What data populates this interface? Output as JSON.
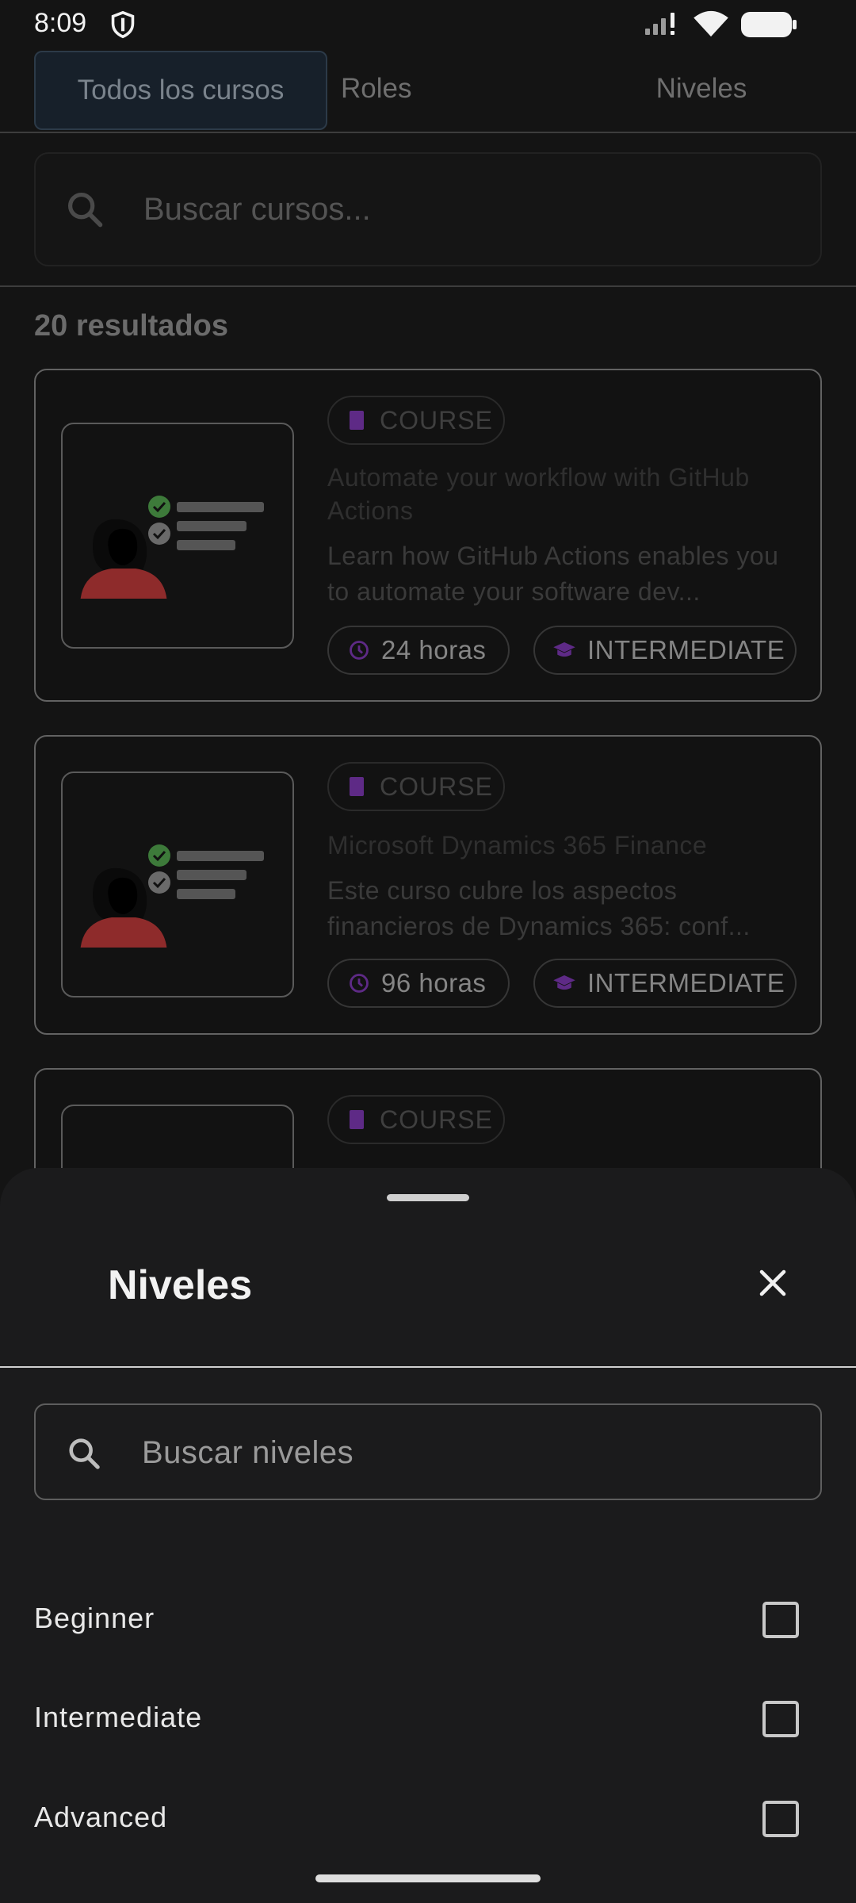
{
  "status_bar": {
    "time": "8:09"
  },
  "tabs": [
    {
      "label": "Todos los cursos"
    },
    {
      "label": "Roles"
    },
    {
      "label": "Niveles"
    }
  ],
  "course_search": {
    "placeholder": "Buscar cursos..."
  },
  "results": {
    "count_label": "20 resultados"
  },
  "courses": [
    {
      "type": "COURSE",
      "title": "Automate your workflow with GitHub Actions",
      "description": "Learn how GitHub Actions enables you to automate your software dev...",
      "duration": "24 horas",
      "level": "INTERMEDIATE"
    },
    {
      "type": "COURSE",
      "title": "Microsoft Dynamics 365 Finance",
      "description": "Este curso cubre los aspectos financieros de Dynamics 365: conf...",
      "duration": "96 horas",
      "level": "INTERMEDIATE"
    },
    {
      "type": "COURSE"
    }
  ],
  "sheet": {
    "title": "Niveles",
    "search_placeholder": "Buscar niveles",
    "options": [
      {
        "label": "Beginner",
        "checked": false
      },
      {
        "label": "Intermediate",
        "checked": false
      },
      {
        "label": "Advanced",
        "checked": false
      }
    ]
  },
  "colors": {
    "accent_purple": "#5e2a86",
    "check_green": "#3d7a3a",
    "avatar_red": "#8e2b2b",
    "sheet_bg": "#1b1b1c"
  }
}
